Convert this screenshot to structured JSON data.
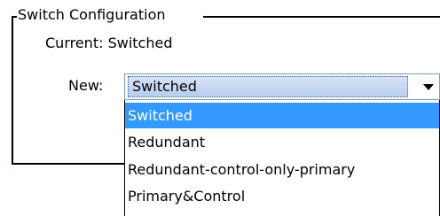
{
  "group": {
    "title": "Switch Configuration"
  },
  "current": {
    "label": "Current: Switched"
  },
  "new": {
    "label": "New:",
    "selected_value": "Switched"
  },
  "dropdown": {
    "options": [
      {
        "label": "Switched",
        "selected": true
      },
      {
        "label": "Redundant",
        "selected": false
      },
      {
        "label": "Redundant-control-only-primary",
        "selected": false
      },
      {
        "label": "Primary&Control",
        "selected": false
      }
    ]
  },
  "colors": {
    "selection_highlight": "#3399ff",
    "combo_border": "#7f9db9"
  },
  "icons": {
    "combo_arrow": "chevron-down-icon"
  }
}
